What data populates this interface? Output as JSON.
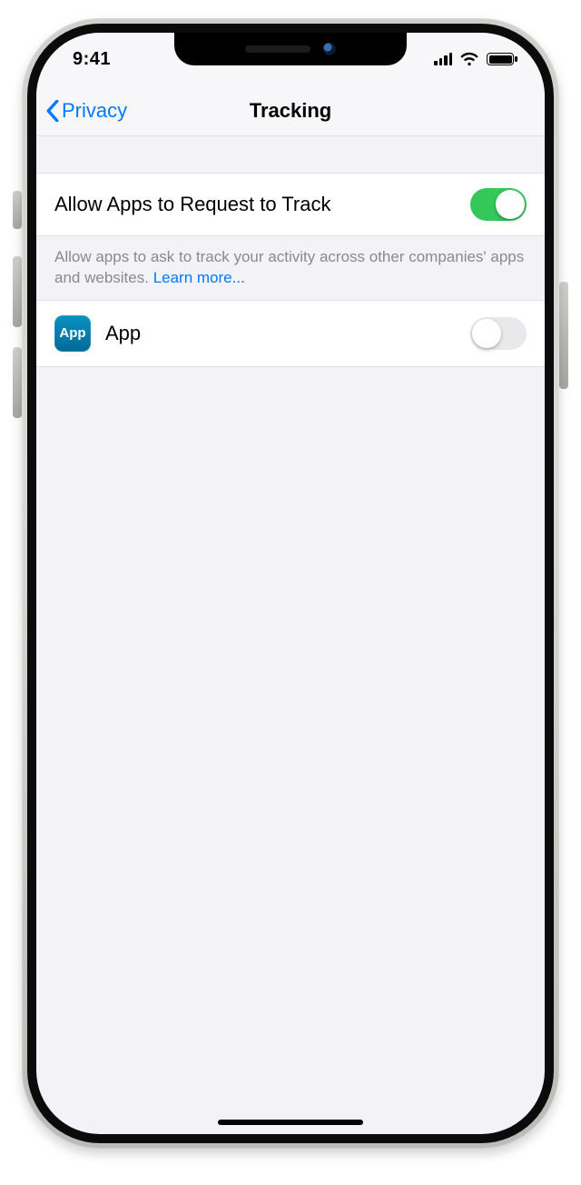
{
  "status": {
    "time": "9:41"
  },
  "nav": {
    "back_label": "Privacy",
    "title": "Tracking"
  },
  "settings": {
    "allow_label": "Allow Apps to Request to Track",
    "allow_value": true,
    "footer_text": "Allow apps to ask to track your activity across other companies' apps and websites. ",
    "learn_more_label": "Learn more..."
  },
  "apps": [
    {
      "name": "App",
      "icon_text": "App",
      "tracking_value": false
    }
  ]
}
